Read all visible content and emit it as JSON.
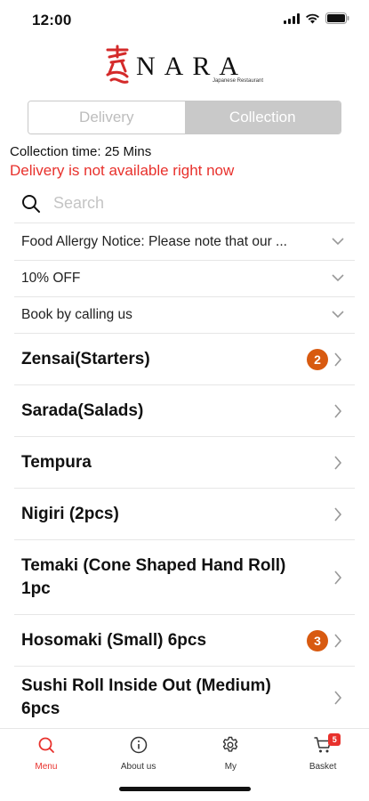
{
  "status": {
    "time": "12:00"
  },
  "brand": {
    "name": "NARA",
    "subtitle": "Japanese Restaurant",
    "kanji": "奈良",
    "color": "#d42a2a"
  },
  "order_mode": {
    "options": [
      "Delivery",
      "Collection"
    ],
    "selected": "Collection"
  },
  "collection_time": "Collection time: 25 Mins",
  "delivery_warning": "Delivery is not available right now",
  "search": {
    "placeholder": "Search"
  },
  "notices": [
    {
      "label": "Food Allergy Notice: Please note that our ..."
    },
    {
      "label": "10% OFF"
    },
    {
      "label": "Book by calling us"
    }
  ],
  "categories": [
    {
      "label": "Zensai(Starters)",
      "count": "2"
    },
    {
      "label": "Sarada(Salads)",
      "count": ""
    },
    {
      "label": "Tempura",
      "count": ""
    },
    {
      "label": "Nigiri (2pcs)",
      "count": ""
    },
    {
      "label": "Temaki (Cone Shaped Hand Roll) 1pc",
      "count": ""
    },
    {
      "label": "Hosomaki (Small) 6pcs",
      "count": "3"
    },
    {
      "label": "Sushi Roll Inside Out (Medium) 6pcs",
      "count": ""
    }
  ],
  "tabbar": {
    "items": [
      {
        "label": "Menu",
        "icon": "search-icon",
        "active": true
      },
      {
        "label": "About us",
        "icon": "info-icon",
        "active": false
      },
      {
        "label": "My",
        "icon": "gear-icon",
        "active": false
      },
      {
        "label": "Basket",
        "icon": "cart-icon",
        "active": false,
        "badge": "5"
      }
    ]
  },
  "colors": {
    "accent": "#e8312c",
    "badge": "#d85a10",
    "segment_selected": "#c9c9c9"
  }
}
